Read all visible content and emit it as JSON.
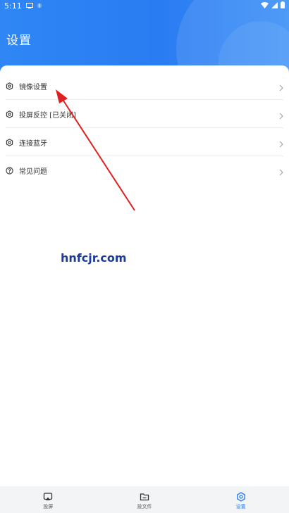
{
  "status_bar": {
    "time": "5:11"
  },
  "header": {
    "title": "设置",
    "color": "#2a7cf2"
  },
  "menu": {
    "items": [
      {
        "label": "镜像设置",
        "icon": "gear-icon"
      },
      {
        "label": "投屏反控 [已关闭]",
        "icon": "gear-icon"
      },
      {
        "label": "连接蓝牙",
        "icon": "gear-icon"
      },
      {
        "label": "常见问题",
        "icon": "question-circle-icon"
      }
    ]
  },
  "watermark": {
    "text": "hnfcjr.com"
  },
  "bottom_nav": {
    "items": [
      {
        "label": "投屏",
        "icon": "cast-icon",
        "active": false
      },
      {
        "label": "投文件",
        "icon": "folder-icon",
        "active": false
      },
      {
        "label": "设置",
        "icon": "hexagon-gear-icon",
        "active": true
      }
    ]
  },
  "colors": {
    "accent": "#2a7cf2",
    "annotation_arrow": "#e02020"
  }
}
